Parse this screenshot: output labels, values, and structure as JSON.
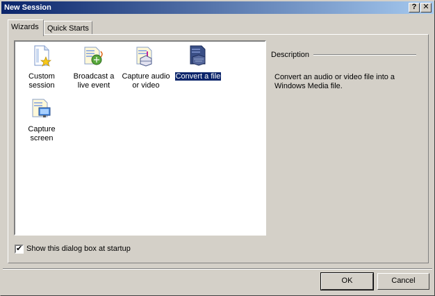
{
  "window": {
    "title": "New Session"
  },
  "title_buttons": {
    "help": "?",
    "close": "✕"
  },
  "tabs": [
    {
      "label": "Wizards",
      "active": true
    },
    {
      "label": "Quick Starts",
      "active": false
    }
  ],
  "wizards": [
    {
      "line1": "Custom",
      "line2": "session",
      "icon": "custom-session-icon"
    },
    {
      "line1": "Broadcast a",
      "line2": "live event",
      "icon": "broadcast-icon"
    },
    {
      "line1": "Capture audio",
      "line2": "or video",
      "icon": "capture-audio-video-icon"
    },
    {
      "line1": "Convert a file",
      "line2": "",
      "icon": "convert-file-icon",
      "selected": true
    },
    {
      "line1": "Capture",
      "line2": "screen",
      "icon": "capture-screen-icon"
    }
  ],
  "description": {
    "heading": "Description",
    "text": "Convert an audio or video file into a Windows Media file."
  },
  "startup_checkbox": {
    "label": "Show this dialog box at startup",
    "checked": true
  },
  "buttons": {
    "ok": "OK",
    "cancel": "Cancel"
  },
  "colors": {
    "title_start": "#0a246a",
    "title_end": "#a6caf0",
    "selection": "#0a246a",
    "face": "#d4d0c8"
  }
}
